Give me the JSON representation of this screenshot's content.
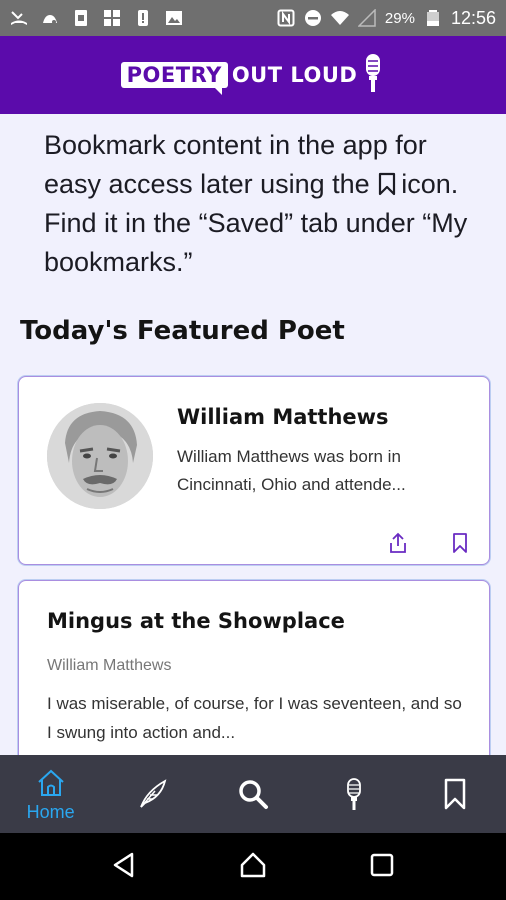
{
  "status_bar": {
    "battery": "29%",
    "time": "12:56",
    "left_icons": [
      "missed-call-icon",
      "voicemail-icon",
      "sim-icon",
      "photo-grid-icon",
      "alert-icon",
      "image-icon"
    ],
    "right_icons": [
      "nfc-icon",
      "dnd-icon",
      "wifi-icon",
      "signal-icon",
      "battery-icon"
    ]
  },
  "header": {
    "logo_box": "POETRY",
    "logo_text": "OUT LOUD",
    "brand_color": "#5b0bab"
  },
  "intro": {
    "text_before": "Bookmark content in the app for easy access later using the",
    "text_after": "icon. Find it in the “Saved” tab under “My bookmarks.”"
  },
  "featured": {
    "section_title": "Today's Featured Poet",
    "poet_name": "William Matthews",
    "poet_bio": "William Matthews was born in Cincinnati, Ohio and attende..."
  },
  "poem": {
    "title": "Mingus at the Showplace",
    "author": "William Matthews",
    "excerpt": "I was miserable, of course, for I was seventeen, and so I swung into action and..."
  },
  "bottom_nav": {
    "items": [
      {
        "label": "Home",
        "icon": "home-icon",
        "active": true
      },
      {
        "label": "",
        "icon": "quill-icon",
        "active": false
      },
      {
        "label": "",
        "icon": "search-icon",
        "active": false
      },
      {
        "label": "",
        "icon": "microphone-icon",
        "active": false
      },
      {
        "label": "",
        "icon": "bookmark-icon",
        "active": false
      }
    ],
    "active_color": "#2aa7f0"
  }
}
